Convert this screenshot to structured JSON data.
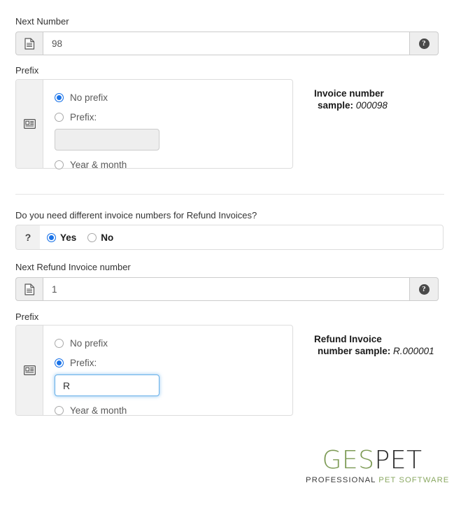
{
  "sections": {
    "invoice": {
      "next_number_label": "Next Number",
      "next_number_value": "98",
      "prefix_label": "Prefix",
      "prefix_options": [
        {
          "label": "No prefix",
          "selected": true
        },
        {
          "label": "Prefix:",
          "selected": false
        },
        {
          "label": "Year & month",
          "selected": false
        }
      ],
      "prefix_input_value": "",
      "sample_line1": "Invoice number",
      "sample_line2_label": "sample:",
      "sample_value": "000098"
    },
    "refund_question": {
      "label": "Do you need different invoice numbers for Refund Invoices?",
      "addon_icon": "?",
      "options": [
        {
          "label": "Yes",
          "selected": true
        },
        {
          "label": "No",
          "selected": false
        }
      ]
    },
    "refund": {
      "next_number_label": "Next Refund Invoice number",
      "next_number_value": "1",
      "prefix_label": "Prefix",
      "prefix_options": [
        {
          "label": "No prefix",
          "selected": false
        },
        {
          "label": "Prefix:",
          "selected": true
        },
        {
          "label": "Year & month",
          "selected": false
        }
      ],
      "prefix_input_value": "R",
      "sample_line1": "Refund Invoice",
      "sample_line2_label": "number sample:",
      "sample_value": "R.000001"
    }
  },
  "icons": {
    "file_text": "file-text-icon",
    "help": "?",
    "address_card": "address-card-icon"
  },
  "logo": {
    "brand_part1": "GES",
    "brand_part2": "PET",
    "tagline_part1": "PROFESSIONAL",
    "tagline_part2": " PET SOFTWARE"
  },
  "colors": {
    "accent_blue": "#1a73e8",
    "focus_blue": "#66afe9",
    "brand_green": "#7d9b55",
    "border_gray": "#dddddd"
  }
}
